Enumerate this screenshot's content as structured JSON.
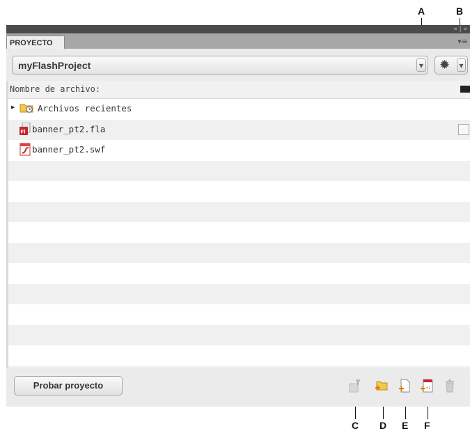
{
  "panel": {
    "tab_label": "PROYECTO",
    "titlebar_controls": "« | »",
    "menu_icon": "panel-menu-icon"
  },
  "toolbar": {
    "project_name": "myFlashProject",
    "settings_icon": "gear-icon"
  },
  "list": {
    "header_label": "Nombre de archivo:",
    "items": [
      {
        "label": "Archivos recientes",
        "icon": "recent-folder-icon"
      },
      {
        "label": "banner_pt2.fla",
        "icon": "fla-file-icon"
      },
      {
        "label": "banner_pt2.swf",
        "icon": "swf-file-icon"
      }
    ]
  },
  "bottom": {
    "test_button_label": "Probar proyecto"
  },
  "callouts": {
    "A": "A",
    "B": "B",
    "C": "C",
    "D": "D",
    "E": "E",
    "F": "F"
  },
  "colors": {
    "titlebar": "#4b4b4b",
    "tabstrip": "#a7a7a7",
    "toolbar": "#ebebeb",
    "row_alt": "#f0f0f0",
    "fla_red": "#c1272d",
    "folder_yellow": "#f2c94c"
  }
}
